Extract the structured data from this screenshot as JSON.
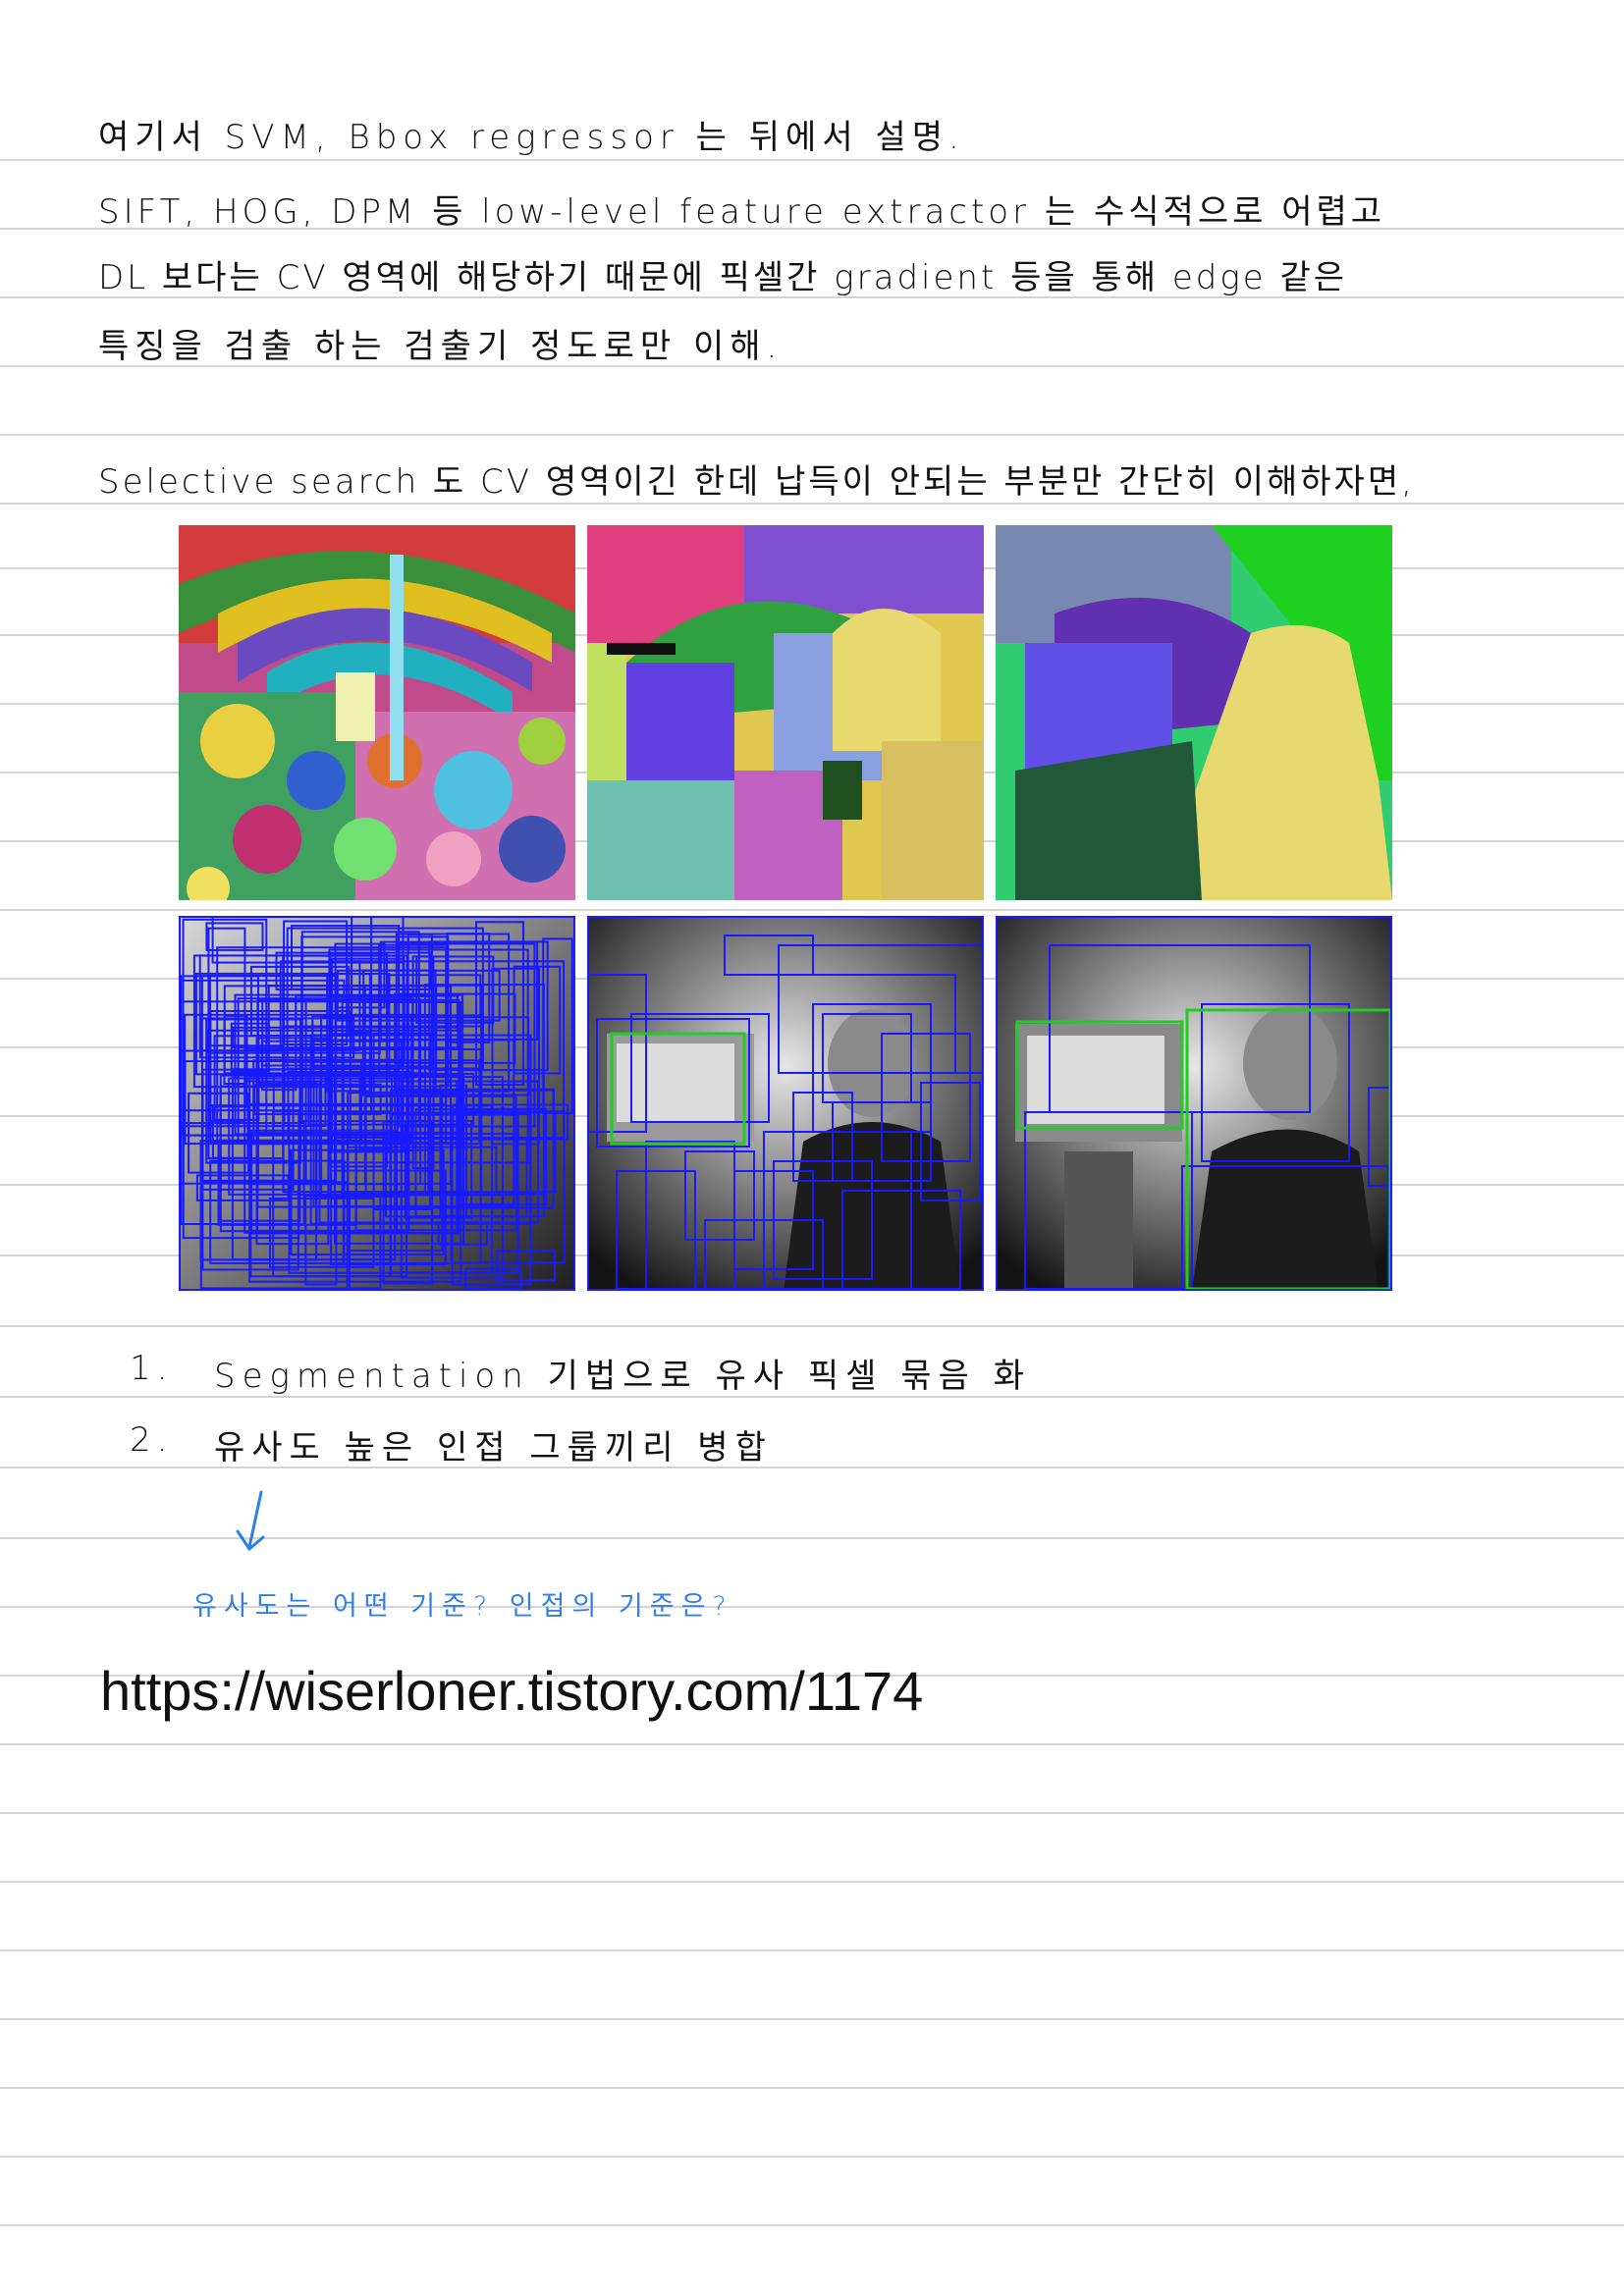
{
  "notes": {
    "line1": "여기서 SVM, Bbox regressor 는 뒤에서 설명.",
    "line2": "SIFT, HOG, DPM 등 low-level feature extractor 는 수식적으로 어렵고",
    "line3": "DL 보다는 CV 영역에 해당하기 때문에 픽셀간 gradient 등을 통해 edge 같은",
    "line4": "특징을 검출 하는 검출기 정도로만 이해.",
    "line5": "Selective search 도 CV 영역이긴 한데 납득이 안되는 부분만 간단히 이해하자면,"
  },
  "figure": {
    "segmentation_row": [
      "segmentation-fine",
      "segmentation-medium",
      "segmentation-coarse"
    ],
    "detection_row": [
      "proposals-many",
      "proposals-medium",
      "proposals-few"
    ],
    "box_color": "#1a1aff",
    "highlight_color": "#22cc22"
  },
  "steps": [
    {
      "num": "1.",
      "text": "Segmentation 기법으로 유사 픽셀 묶음 화"
    },
    {
      "num": "2.",
      "text": "유사도 높은 인접 그룹끼리 병합"
    }
  ],
  "question": "유사도는 어떤 기준? 인접의 기준은?",
  "link": "https://wiserloner.tistory.com/1174",
  "colors": {
    "ink": "#111111",
    "pen_blue": "#2f7fe8",
    "rule": "#d4d4d4"
  }
}
